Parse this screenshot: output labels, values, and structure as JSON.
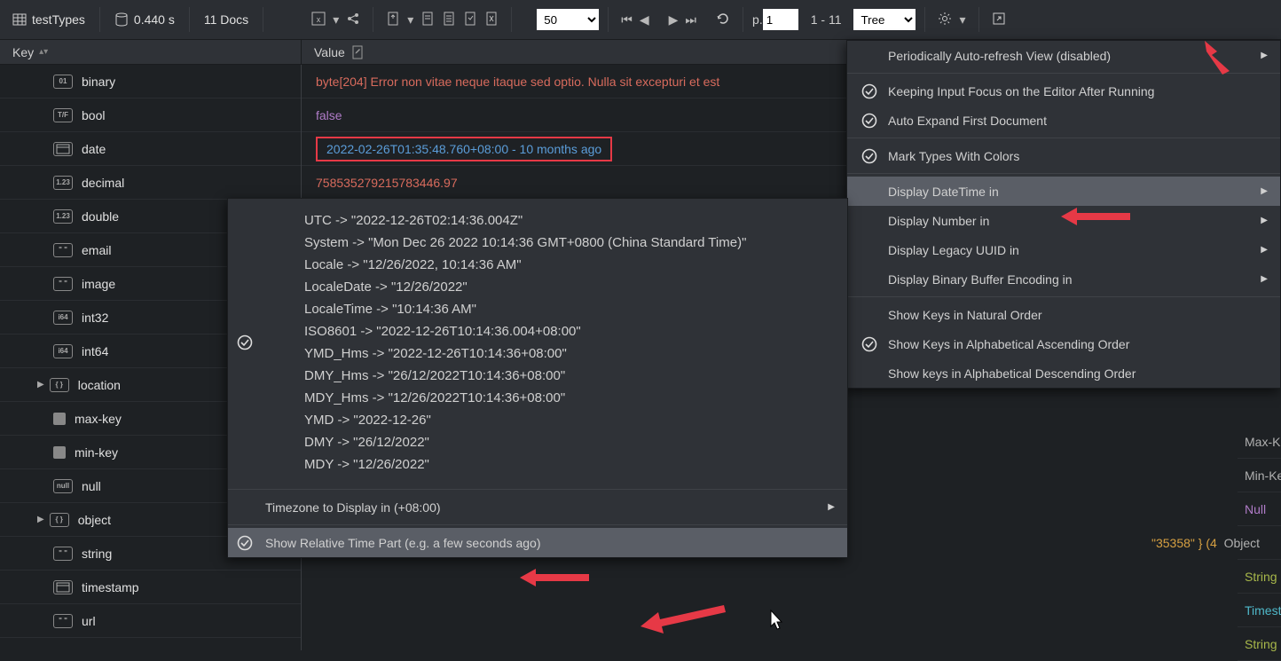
{
  "toolbar": {
    "collection": "testTypes",
    "time": "0.440 s",
    "docs": "11 Docs",
    "page_size_options": [
      "50"
    ],
    "page_size": "50",
    "page_label": "p.",
    "page_value": "1",
    "range": "1 - 11",
    "view_mode": "Tree",
    "view_mode_options": [
      "Tree"
    ]
  },
  "headers": {
    "key": "Key",
    "value": "Value"
  },
  "keys": [
    {
      "icon": "bin",
      "label": "binary"
    },
    {
      "icon": "tf",
      "label": "bool"
    },
    {
      "icon": "cal",
      "label": "date"
    },
    {
      "icon": "num",
      "label": "decimal"
    },
    {
      "icon": "num",
      "label": "double"
    },
    {
      "icon": "txt",
      "label": "email"
    },
    {
      "icon": "txt",
      "label": "image"
    },
    {
      "icon": "i64",
      "label": "int32"
    },
    {
      "icon": "i64",
      "label": "int64"
    },
    {
      "icon": "obj",
      "label": "location",
      "expand": true
    },
    {
      "icon": "sq",
      "label": "max-key"
    },
    {
      "icon": "sq",
      "label": "min-key"
    },
    {
      "icon": "null",
      "label": "null"
    },
    {
      "icon": "obj",
      "label": "object",
      "expand": true
    },
    {
      "icon": "txt",
      "label": "string"
    },
    {
      "icon": "cal",
      "label": "timestamp"
    },
    {
      "icon": "txt",
      "label": "url"
    }
  ],
  "values": {
    "binary": "byte[204] Error non vitae neque itaque sed optio. Nulla sit excepturi et est ",
    "bool": "false",
    "date": "2022-02-26T01:35:48.760+08:00 - 10 months ago",
    "decimal": "758535279215783446.97"
  },
  "right_values": {
    "obj_fragment": "\"35358\" } (4",
    "types": [
      "Max-Key",
      "Min-Key",
      "Null",
      "Object",
      "String",
      "Timestamp",
      "String"
    ]
  },
  "settings_menu": [
    {
      "check": false,
      "label": "Periodically Auto-refresh View (disabled)",
      "arrow": true
    },
    {
      "sep": true
    },
    {
      "check": true,
      "label": "Keeping Input Focus on the Editor After Running"
    },
    {
      "check": true,
      "label": "Auto Expand First Document"
    },
    {
      "sep": true
    },
    {
      "check": true,
      "label": "Mark Types With Colors"
    },
    {
      "sep": true
    },
    {
      "check": false,
      "label": "Display DateTime in",
      "arrow": true,
      "highlight": true
    },
    {
      "check": false,
      "label": "Display Number in",
      "arrow": true
    },
    {
      "check": false,
      "label": "Display Legacy UUID in",
      "arrow": true
    },
    {
      "check": false,
      "label": "Display Binary Buffer Encoding in",
      "arrow": true
    },
    {
      "sep": true
    },
    {
      "check": false,
      "label": "Show Keys in Natural Order"
    },
    {
      "check": true,
      "label": "Show Keys in Alphabetical Ascending Order"
    },
    {
      "check": false,
      "label": "Show keys in Alphabetical Descending Order"
    }
  ],
  "dt_submenu": {
    "formats": [
      "UTC -> \"2022-12-26T02:14:36.004Z\"",
      "System -> \"Mon Dec 26 2022 10:14:36 GMT+0800 (China Standard Time)\"",
      "Locale -> \"12/26/2022, 10:14:36 AM\"",
      "LocaleDate -> \"12/26/2022\"",
      "LocaleTime -> \"10:14:36 AM\"",
      "ISO8601 -> \"2022-12-26T10:14:36.004+08:00\"",
      "YMD_Hms -> \"2022-12-26T10:14:36+08:00\"",
      "DMY_Hms -> \"26/12/2022T10:14:36+08:00\"",
      "MDY_Hms -> \"12/26/2022T10:14:36+08:00\"",
      "YMD -> \"2022-12-26\"",
      "DMY -> \"26/12/2022\"",
      "MDY -> \"12/26/2022\""
    ],
    "timezone_label": "Timezone to Display in (+08:00)",
    "relative_label": "Show Relative Time Part (e.g. a few seconds ago)"
  }
}
